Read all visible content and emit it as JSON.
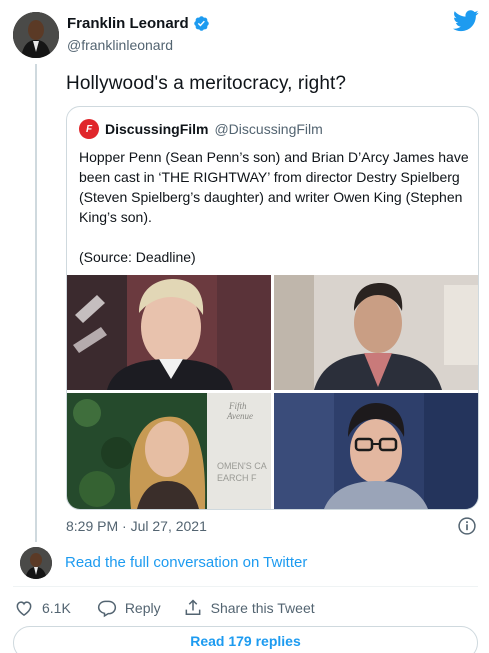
{
  "author": {
    "name": "Franklin Leonard",
    "handle": "@franklinleonard"
  },
  "tweet": {
    "text": "Hollywood's a meritocracy, right?",
    "timestamp": "8:29 PM · Jul 27, 2021"
  },
  "quoted_tweet": {
    "logo_text": "F",
    "name": "DiscussingFilm",
    "handle": "@DiscussingFilm",
    "body": "Hopper Penn (Sean Penn’s son) and Brian D’Arcy James have been cast in ‘THE RIGHTWAY’ from director Destry Spielberg (Steven Spielberg’s daughter) and writer Owen King (Stephen King’s son).",
    "source": "(Source: Deadline)",
    "media_overlay_text": {
      "photo3_sign": "OMEN'S CA\nEARCH F",
      "photo3_logo": "Fifth\nAvenue"
    }
  },
  "read_conversation": "Read the full conversation on Twitter",
  "actions": {
    "like_count": "6.1K",
    "reply_label": "Reply",
    "share_label": "Share this Tweet"
  },
  "read_replies": "Read 179 replies",
  "colors": {
    "accent": "#1d9bf0",
    "secondary_text": "#536471",
    "border": "#cfd9de",
    "brand_red": "#e0262b"
  },
  "icons": [
    "verified-badge-icon",
    "twitter-bird-icon",
    "info-icon",
    "heart-icon",
    "reply-bubble-icon",
    "share-icon"
  ]
}
